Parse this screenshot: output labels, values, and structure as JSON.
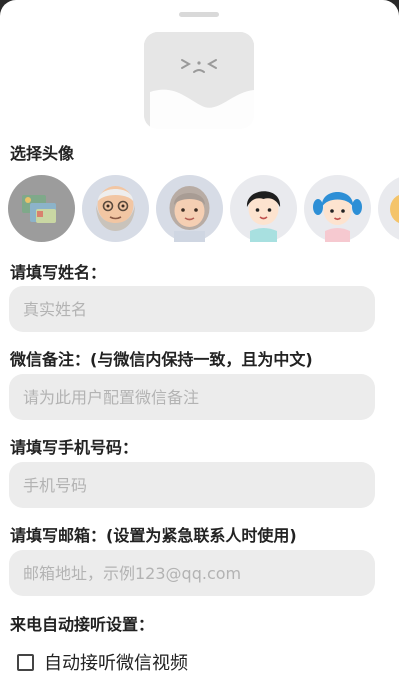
{
  "sections": {
    "avatar_title": "选择头像",
    "name_title": "请填写姓名：",
    "remark_title": "微信备注：(与微信内保持一致，且为中文)",
    "phone_title": "请填写手机号码：",
    "email_title": "请填写邮箱：(设置为紧急联系人时使用)",
    "autoanswer_title": "来电自动接听设置："
  },
  "fields": {
    "name_placeholder": "真实姓名",
    "remark_placeholder": "请为此用户配置微信备注",
    "phone_placeholder": "手机号码",
    "email_placeholder": "邮箱地址，示例123@qq.com"
  },
  "checkbox": {
    "auto_answer_label": "自动接听微信视频",
    "checked": false
  },
  "avatars": [
    {
      "name": "custom-photo",
      "selected": true
    },
    {
      "name": "elderly-man"
    },
    {
      "name": "elderly-woman"
    },
    {
      "name": "boy"
    },
    {
      "name": "girl"
    },
    {
      "name": "more"
    }
  ],
  "colors": {
    "field_bg": "#ececec",
    "placeholder": "#b3b3b3",
    "avatar_bg": "#e3e5ea"
  }
}
